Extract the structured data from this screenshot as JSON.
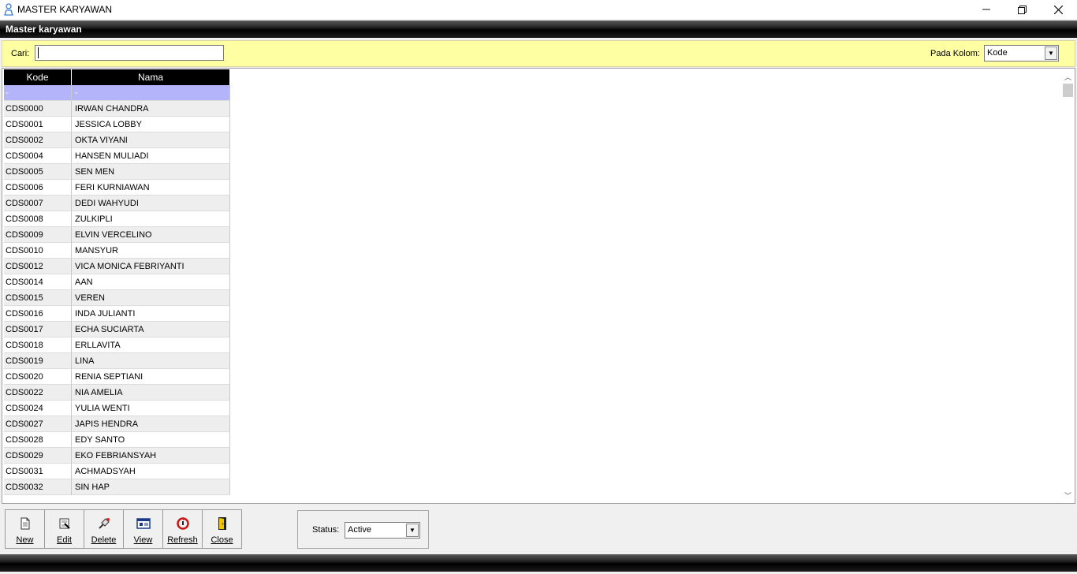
{
  "window": {
    "title": "MASTER KARYAWAN"
  },
  "header": {
    "title": "Master karyawan"
  },
  "search": {
    "label": "Cari:",
    "value": "",
    "column_label": "Pada Kolom:",
    "column_value": "Kode"
  },
  "grid": {
    "columns": [
      "Kode",
      "Nama"
    ],
    "rows": [
      {
        "kode": "-",
        "nama": "-"
      },
      {
        "kode": "CDS0000",
        "nama": "IRWAN CHANDRA"
      },
      {
        "kode": "CDS0001",
        "nama": "JESSICA LOBBY"
      },
      {
        "kode": "CDS0002",
        "nama": "OKTA VIYANI"
      },
      {
        "kode": "CDS0004",
        "nama": "HANSEN MULIADI"
      },
      {
        "kode": "CDS0005",
        "nama": "SEN MEN"
      },
      {
        "kode": "CDS0006",
        "nama": "FERI KURNIAWAN"
      },
      {
        "kode": "CDS0007",
        "nama": "DEDI WAHYUDI"
      },
      {
        "kode": "CDS0008",
        "nama": "ZULKIPLI"
      },
      {
        "kode": "CDS0009",
        "nama": "ELVIN VERCELINO"
      },
      {
        "kode": "CDS0010",
        "nama": "MANSYUR"
      },
      {
        "kode": "CDS0012",
        "nama": "VICA MONICA FEBRIYANTI"
      },
      {
        "kode": "CDS0014",
        "nama": "AAN"
      },
      {
        "kode": "CDS0015",
        "nama": "VEREN"
      },
      {
        "kode": "CDS0016",
        "nama": "INDA JULIANTI"
      },
      {
        "kode": "CDS0017",
        "nama": "ECHA SUCIARTA"
      },
      {
        "kode": "CDS0018",
        "nama": "ERLLAVITA"
      },
      {
        "kode": "CDS0019",
        "nama": "LINA"
      },
      {
        "kode": "CDS0020",
        "nama": "RENIA SEPTIANI"
      },
      {
        "kode": "CDS0022",
        "nama": "NIA AMELIA"
      },
      {
        "kode": "CDS0024",
        "nama": "YULIA WENTI"
      },
      {
        "kode": "CDS0027",
        "nama": "JAPIS HENDRA"
      },
      {
        "kode": "CDS0028",
        "nama": "EDY SANTO"
      },
      {
        "kode": "CDS0029",
        "nama": "EKO FEBRIANSYAH"
      },
      {
        "kode": "CDS0031",
        "nama": "ACHMADSYAH"
      },
      {
        "kode": "CDS0032",
        "nama": "SIN HAP"
      }
    ]
  },
  "toolbar": {
    "buttons": [
      {
        "label": "New",
        "icon": "new-document-icon"
      },
      {
        "label": "Edit",
        "icon": "edit-icon"
      },
      {
        "label": "Delete",
        "icon": "delete-icon"
      },
      {
        "label": "View",
        "icon": "view-icon"
      },
      {
        "label": "Refresh",
        "icon": "refresh-icon"
      },
      {
        "label": "Close",
        "icon": "close-door-icon"
      }
    ]
  },
  "status": {
    "label": "Status:",
    "value": "Active"
  },
  "colors": {
    "search_bar_bg": "#fefea2",
    "header_bg": "#000000",
    "selected_row": "#b4b4fa",
    "alt_row": "#eeeeee"
  }
}
